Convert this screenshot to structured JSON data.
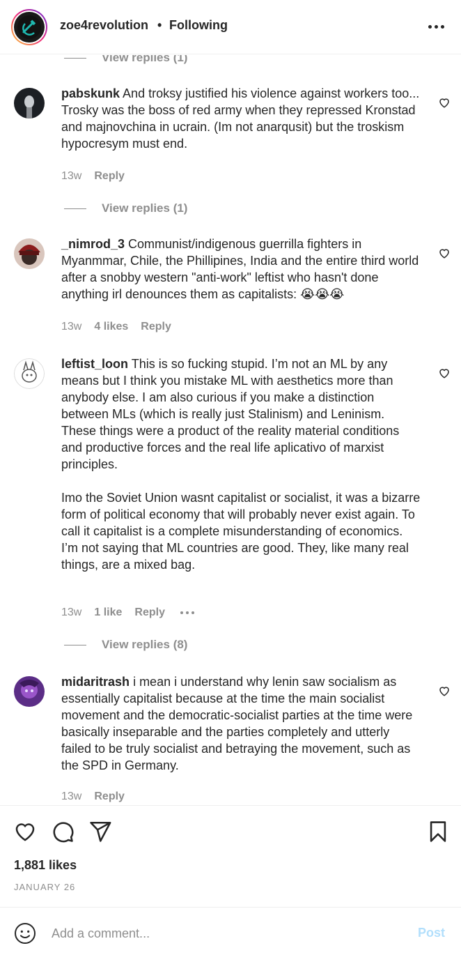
{
  "header": {
    "username": "zoe4revolution",
    "separator": "•",
    "follow_status": "Following"
  },
  "top_view_replies": "View replies (1)",
  "comments": [
    {
      "username": "pabskunk",
      "paragraphs": [
        "And troksy justified his violence against workers too... Trosky was the boss of red army when they repressed Kronstad and majnovchina in ucrain. (Im not anarqusit) but the troskism hypocresym must end."
      ],
      "time": "13w",
      "likes": "",
      "reply": "Reply",
      "view_replies": "View replies (1)"
    },
    {
      "username": "_nimrod_3",
      "paragraphs": [
        "Communist/indigenous guerrilla fighters in Myanmmar, Chile, the Phillipines, India and the entire third world after a snobby western \"anti-work\" leftist who hasn't done anything irl denounces them as capitalists: 😭😭😭"
      ],
      "time": "13w",
      "likes": "4 likes",
      "reply": "Reply",
      "view_replies": ""
    },
    {
      "username": "leftist_loon",
      "paragraphs": [
        "This is so fucking stupid. I’m not an ML by any means but I think you mistake ML with aesthetics more than anybody else. I am also curious if you make a distinction between MLs (which is really just Stalinism) and Leninism. These things were a product of the reality material conditions and productive forces and the real life aplicativo of marxist principles.",
        "Imo the Soviet Union wasnt capitalist or socialist, it was a bizarre form of political economy that will probably never exist again. To call it capitalist is a complete misunderstanding of economics. I’m not saying that ML countries are good. They, like many real things, are a mixed bag."
      ],
      "time": "13w",
      "likes": "1 like",
      "reply": "Reply",
      "view_replies": "View replies (8)"
    },
    {
      "username": "midaritrash",
      "paragraphs": [
        "i mean i understand why lenin saw socialism as essentially capitalist because at the time the main socialist movement and the democratic-socialist parties at the time were basically inseparable and the parties completely and utterly failed to be truly socialist and betraying the movement, such as the SPD in Germany."
      ],
      "time": "13w",
      "likes": "",
      "reply": "Reply",
      "view_replies": ""
    }
  ],
  "post": {
    "likes": "1,881 likes",
    "date": "JANUARY 26"
  },
  "add_comment": {
    "placeholder": "Add a comment...",
    "post_label": "Post"
  },
  "colors": {
    "text": "#262626",
    "secondary": "#8e8e8e",
    "post_disabled": "#b2dffc"
  }
}
